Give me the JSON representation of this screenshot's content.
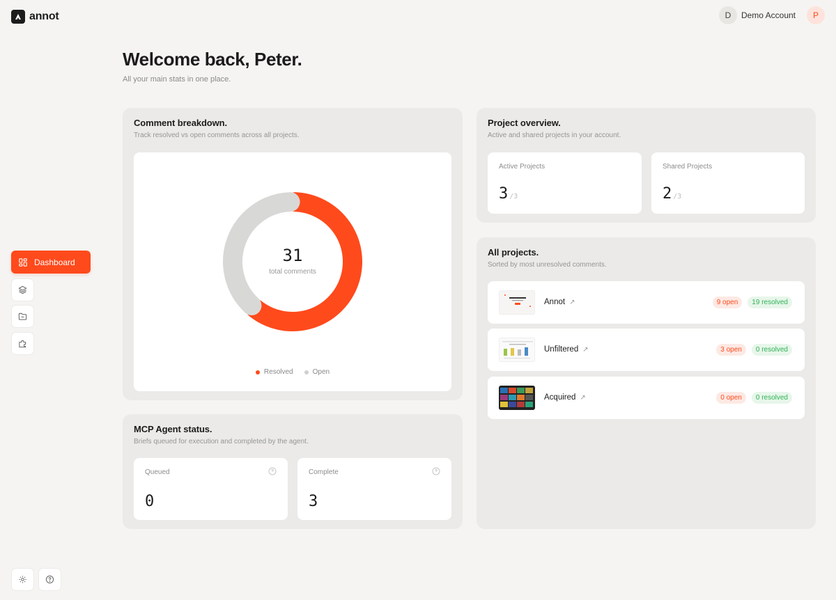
{
  "app": {
    "name": "annot"
  },
  "account": {
    "avatar_initial": "D",
    "name": "Demo Account",
    "user_initial": "P"
  },
  "sidebar": {
    "active_item": "Dashboard"
  },
  "page": {
    "title": "Welcome back, Peter.",
    "subtitle": "All your main stats in one place."
  },
  "comment_breakdown": {
    "title": "Comment breakdown.",
    "subtitle": "Track resolved vs open comments across all projects.",
    "total": "31",
    "total_label": "total comments",
    "legend": {
      "resolved": "Resolved",
      "open": "Open"
    },
    "colors": {
      "resolved": "#ff4a1c",
      "open": "#d8d8d6"
    }
  },
  "chart_data": {
    "type": "pie",
    "categories": [
      "Resolved",
      "Open"
    ],
    "values": [
      19,
      12
    ],
    "title": "Comment breakdown.",
    "center_value": 31
  },
  "mcp_status": {
    "title": "MCP Agent status.",
    "subtitle": "Briefs queued for execution and completed by the agent.",
    "queued": {
      "label": "Queued",
      "value": "0"
    },
    "complete": {
      "label": "Complete",
      "value": "3"
    }
  },
  "project_overview": {
    "title": "Project overview.",
    "subtitle": "Active and shared projects in your account.",
    "active": {
      "label": "Active Projects",
      "value": "3",
      "total": "/3"
    },
    "shared": {
      "label": "Shared Projects",
      "value": "2",
      "total": "/3"
    }
  },
  "all_projects": {
    "title": "All projects.",
    "subtitle": "Sorted by most unresolved comments.",
    "items": [
      {
        "name": "Annot",
        "open": "9 open",
        "resolved": "19 resolved"
      },
      {
        "name": "Unfiltered",
        "open": "3 open",
        "resolved": "0 resolved"
      },
      {
        "name": "Acquired",
        "open": "0 open",
        "resolved": "0 resolved"
      }
    ]
  }
}
